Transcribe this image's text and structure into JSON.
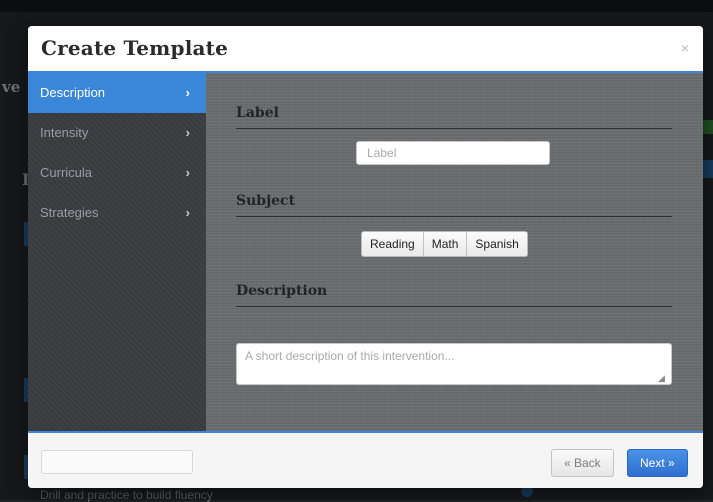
{
  "background": {
    "heading_fragment": "ve",
    "letter_fragment": "I",
    "footer_text": "Drill and practice to build fluency"
  },
  "modal": {
    "title": "Create Template",
    "close_glyph": "×"
  },
  "sidebar": {
    "items": [
      {
        "label": "Description",
        "active": true
      },
      {
        "label": "Intensity",
        "active": false
      },
      {
        "label": "Curricula",
        "active": false
      },
      {
        "label": "Strategies",
        "active": false
      }
    ],
    "chevron": "›"
  },
  "form": {
    "label": {
      "heading": "Label",
      "placeholder": "Label",
      "value": ""
    },
    "subject": {
      "heading": "Subject",
      "options": [
        "Reading",
        "Math",
        "Spanish"
      ]
    },
    "description": {
      "heading": "Description",
      "placeholder": "A short description of this intervention...",
      "value": ""
    }
  },
  "footer": {
    "back_label": "« Back",
    "next_label": "Next »"
  },
  "colors": {
    "accent": "#3a86d8",
    "sidebar_bg": "#3a3c40",
    "content_bg": "#6b6d70"
  }
}
